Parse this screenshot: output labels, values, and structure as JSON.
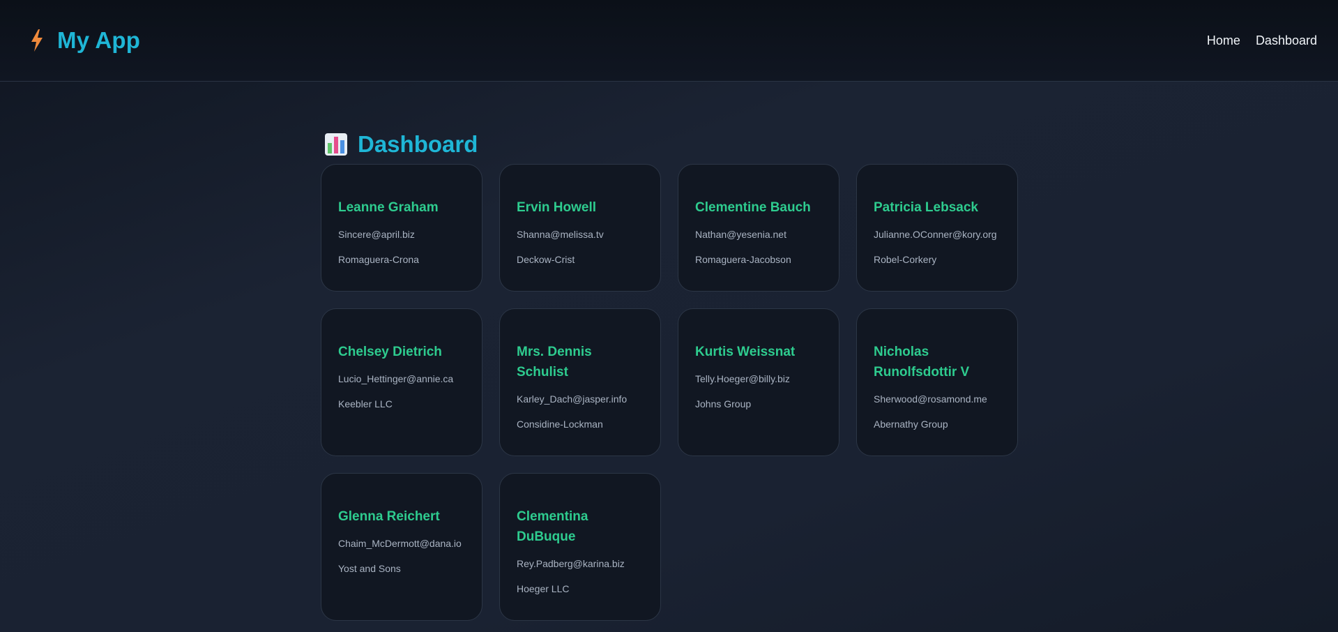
{
  "header": {
    "app_title": "My App",
    "logo_icon": "lightning-bolt-icon",
    "nav": [
      {
        "label": "Home"
      },
      {
        "label": "Dashboard"
      }
    ]
  },
  "dashboard": {
    "title": "Dashboard",
    "title_icon": "bar-chart-icon",
    "users": [
      {
        "name": "Leanne Graham",
        "email": "Sincere@april.biz",
        "company": "Romaguera-Crona"
      },
      {
        "name": "Ervin Howell",
        "email": "Shanna@melissa.tv",
        "company": "Deckow-Crist"
      },
      {
        "name": "Clementine Bauch",
        "email": "Nathan@yesenia.net",
        "company": "Romaguera-Jacobson"
      },
      {
        "name": "Patricia Lebsack",
        "email": "Julianne.OConner@kory.org",
        "company": "Robel-Corkery"
      },
      {
        "name": "Chelsey Dietrich",
        "email": "Lucio_Hettinger@annie.ca",
        "company": "Keebler LLC"
      },
      {
        "name": "Mrs. Dennis Schulist",
        "email": "Karley_Dach@jasper.info",
        "company": "Considine-Lockman"
      },
      {
        "name": "Kurtis Weissnat",
        "email": "Telly.Hoeger@billy.biz",
        "company": "Johns Group"
      },
      {
        "name": "Nicholas Runolfsdottir V",
        "email": "Sherwood@rosamond.me",
        "company": "Abernathy Group"
      },
      {
        "name": "Glenna Reichert",
        "email": "Chaim_McDermott@dana.io",
        "company": "Yost and Sons"
      },
      {
        "name": "Clementina DuBuque",
        "email": "Rey.Padberg@karina.biz",
        "company": "Hoeger LLC"
      }
    ]
  },
  "colors": {
    "accent": "#1fb6d6",
    "name_green": "#2ecc8f",
    "card_bg": "#111722",
    "card_border": "#2c3646",
    "logo_orange": "#f08a3c"
  }
}
